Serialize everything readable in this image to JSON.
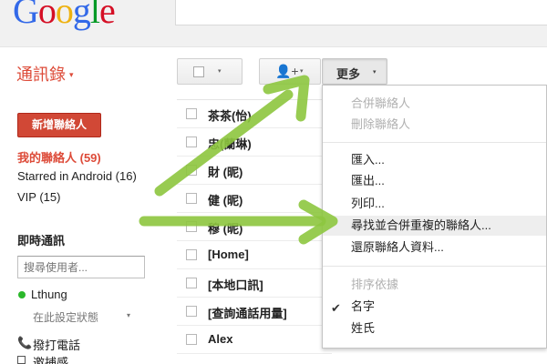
{
  "header": {
    "logo_letters": [
      {
        "ch": "G",
        "color": "#3369e8"
      },
      {
        "ch": "o",
        "color": "#d50f25"
      },
      {
        "ch": "o",
        "color": "#eeb211"
      },
      {
        "ch": "g",
        "color": "#3369e8"
      },
      {
        "ch": "l",
        "color": "#009925"
      },
      {
        "ch": "e",
        "color": "#d50f25"
      }
    ]
  },
  "sidebar": {
    "app_title": "通訊錄",
    "app_title_caret": "▾",
    "new_contact_label": "新增聯絡人",
    "groups": [
      {
        "label": "我的聯絡人 (59)"
      },
      {
        "label": "Starred in Android (16)"
      },
      {
        "label": "VIP (15)"
      }
    ],
    "chat": {
      "title": "即時通訊",
      "search_placeholder": "搜尋使用者...",
      "user_name": "Lthung",
      "status_text": "在此設定狀態",
      "status_caret": "▾",
      "call_label": "撥打電話",
      "extra_label": "邀捕感"
    }
  },
  "toolbar": {
    "select_caret": "▾",
    "add_people_icon": "add-person-icon",
    "add_people_glyph": "👤+",
    "add_caret": "▾",
    "more_label": "更多",
    "more_caret": "▾"
  },
  "contacts": [
    {
      "name": "茶茶(怡)"
    },
    {
      "name": "忠(蘭琳)"
    },
    {
      "name": "財 (昵)"
    },
    {
      "name": "健 (昵)"
    },
    {
      "name": "穆 (昵)"
    },
    {
      "name": "[Home]"
    },
    {
      "name": "[本地口訊]"
    },
    {
      "name": "[查詢通話用量]"
    },
    {
      "name": "Alex"
    }
  ],
  "more_menu": {
    "items": [
      {
        "label": "合併聯絡人",
        "disabled": true
      },
      {
        "label": "刪除聯絡人",
        "disabled": true
      },
      {
        "label": "匯入...",
        "disabled": false
      },
      {
        "label": "匯出...",
        "disabled": false
      },
      {
        "label": "列印...",
        "disabled": false
      },
      {
        "label": "尋找並合併重複的聯絡人...",
        "disabled": false,
        "highlighted": true
      },
      {
        "label": "還原聯絡人資料...",
        "disabled": false
      },
      {
        "label": "排序依據",
        "disabled": true
      },
      {
        "label": "名字",
        "disabled": false,
        "checked": true
      },
      {
        "label": "姓氏",
        "disabled": false
      }
    ],
    "check_glyph": "✔"
  },
  "colors": {
    "accent_red": "#dd4b39",
    "button_red": "#d14836",
    "arrow_green": "#8dc63f",
    "status_green": "#2bb82b"
  }
}
